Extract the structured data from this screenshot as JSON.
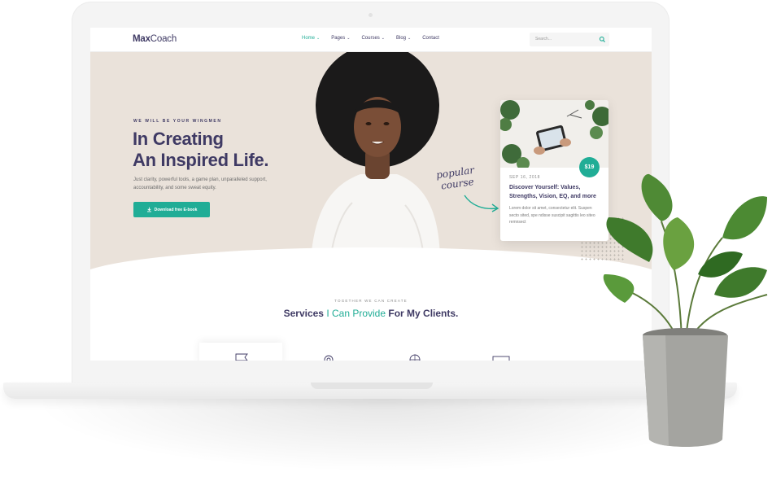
{
  "site": {
    "logo_bold": "Max",
    "logo_regular": "Coach"
  },
  "nav": {
    "items": [
      {
        "label": "Home",
        "caret": "⌄",
        "active": true
      },
      {
        "label": "Pages",
        "caret": "⌄",
        "active": false
      },
      {
        "label": "Courses",
        "caret": "⌄",
        "active": false
      },
      {
        "label": "Blog",
        "caret": "⌄",
        "active": false
      },
      {
        "label": "Contact",
        "caret": "",
        "active": false
      }
    ],
    "search_placeholder": "Search..."
  },
  "hero": {
    "kicker": "WE WILL BE YOUR WINGMEN",
    "headline_line1": "In Creating",
    "headline_line2": "An Inspired Life.",
    "subtext": "Just clarity, powerful tools, a game plan, unparalleled support, accountability, and some sweat equity.",
    "cta_label": "Download free E-book",
    "handwritten_line1": "popular",
    "handwritten_line2": "course"
  },
  "card": {
    "price": "$19",
    "date": "SEP 16, 2018",
    "title": "Discover Yourself: Values, Strengths, Vision, EQ, and more",
    "description": "Lorem dolor sit amet, consectetur elit. Suspen secto sited, spe ndisse suscipit sagittis leo siteo remnsect"
  },
  "services": {
    "kicker": "TOGETHER WE CAN CREATE",
    "title_part1": "Services",
    "title_highlight": "I Can Provide",
    "title_part2": "For My Clients."
  },
  "colors": {
    "brand_navy": "#3f3a64",
    "accent_teal": "#20ad96",
    "hero_bg": "#eae2da"
  },
  "icons": [
    "search-icon",
    "download-icon",
    "flag-icon",
    "gear-icon",
    "compass-icon",
    "monitor-icon"
  ]
}
